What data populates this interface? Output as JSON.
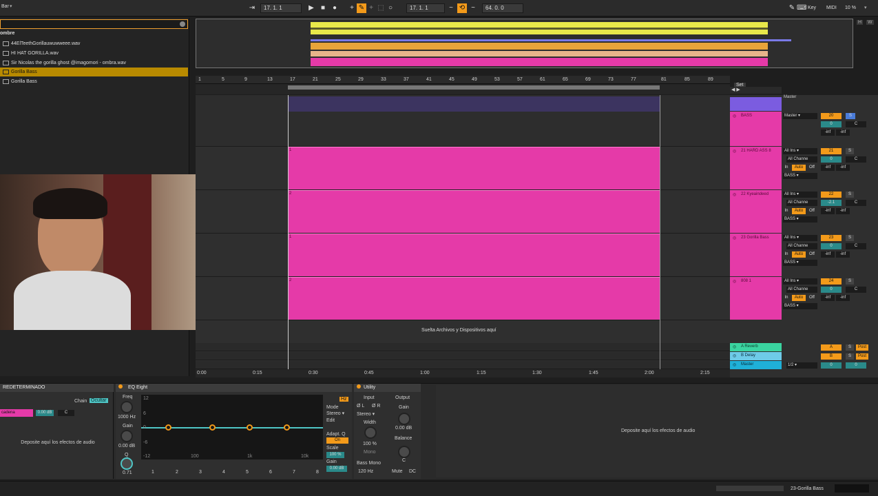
{
  "topbar": {
    "left_label": "Bar",
    "arr_pos": "17.  1.  1",
    "loop_pos": "17.  1.  1",
    "loop_len": "64.  0.  0",
    "key": "Key",
    "midi": "MIDI",
    "cpu": "10 %"
  },
  "browser": {
    "header": "ombre",
    "items": [
      {
        "label": "44ElTeethGorillauwuwweee.wav",
        "selected": false
      },
      {
        "label": "HI HAT GORILLA.wav",
        "selected": false
      },
      {
        "label": "Sir Nicolas the gorilla ghost @imagomori - ombra.wav",
        "selected": false
      },
      {
        "label": "Gorilla Bass",
        "selected": true
      },
      {
        "label": "Gorilla Bass",
        "selected": false
      }
    ]
  },
  "ruler": [
    "1",
    "5",
    "9",
    "13",
    "17",
    "21",
    "25",
    "29",
    "33",
    "37",
    "41",
    "45",
    "49",
    "53",
    "57",
    "61",
    "65",
    "69",
    "73",
    "77",
    "81",
    "85",
    "89"
  ],
  "set_label": "Set",
  "clip_numbers": [
    "1",
    "2",
    "1",
    "2",
    "1",
    "2",
    "1",
    "2",
    "1"
  ],
  "drop_text": "Suelta Archivos y Dispositivos aquí",
  "time_labels": [
    "0:00",
    "0:15",
    "0:30",
    "0:45",
    "1:00",
    "1:15",
    "1:30",
    "1:45",
    "2:00",
    "2:15"
  ],
  "mixer": {
    "top_label": "Master",
    "tracks": [
      {
        "name": "BASS",
        "in_label": "Master",
        "num": "20",
        "vol": "0",
        "pan": "C",
        "left_inf": "-inf",
        "right_inf": "-inf"
      },
      {
        "name": "21 HARD ASS 8",
        "in_label": "All Ins",
        "chan": "All Channe",
        "out": "BASS",
        "num": "21",
        "vol": "0",
        "pan": "C",
        "left_inf": "-inf",
        "right_inf": "-inf"
      },
      {
        "name": "22 Kyeaindeed",
        "in_label": "All Ins",
        "chan": "All Channe",
        "out": "BASS",
        "num": "22",
        "vol": "-2.1",
        "pan": "C",
        "left_inf": "-inf",
        "right_inf": "-inf"
      },
      {
        "name": "23 Gorilla Bass",
        "in_label": "All Ins",
        "chan": "All Channe",
        "out": "BASS",
        "num": "23",
        "vol": "0",
        "pan": "C",
        "left_inf": "-inf",
        "right_inf": "-inf"
      },
      {
        "name": "808 1",
        "in_label": "All Ins",
        "chan": "All Channe",
        "out": "BASS",
        "num": "24",
        "vol": "0",
        "pan": "C",
        "left_inf": "-inf",
        "right_inf": "-inf"
      }
    ],
    "monitor": {
      "in": "In",
      "auto": "Auto",
      "off": "Off"
    },
    "returns": [
      {
        "name": "A Reverb",
        "letter": "A",
        "post": "Post",
        "solo": "S"
      },
      {
        "name": "B Delay",
        "letter": "B",
        "post": "Post",
        "solo": "S"
      },
      {
        "name": "Master",
        "letter": "0",
        "cue": "1/2",
        "vol": "0"
      }
    ]
  },
  "devices": {
    "rack_title": "REDETERMINADO",
    "chain_label": "Chain",
    "chain_value": "Ocultar",
    "cadena": "cadena",
    "cadena_db": "0.00 dB",
    "cadena_c": "C",
    "drop_audio": "Deposite aquí los efectos de audio",
    "eq": {
      "title": "EQ Eight",
      "freq_label": "Freq",
      "freq_value": "1000 Hz",
      "gain_label": "Gain",
      "gain_value": "0.00 dB",
      "q_label": "Q",
      "q_value": "0.71",
      "db_ticks": [
        "12",
        "6",
        "0",
        "-6",
        "-12"
      ],
      "hz_ticks": [
        "100",
        "1k",
        "10k"
      ],
      "mode_label": "Mode",
      "mode_value": "Stereo",
      "edit_label": "Edit",
      "adapt_label": "Adapt. Q",
      "adapt_value": "On",
      "scale_label": "Scale",
      "scale_value": "100 %",
      "out_gain_label": "Gain",
      "out_gain_value": "0.00 dB",
      "bands": [
        "1",
        "2",
        "3",
        "4",
        "5",
        "6",
        "7",
        "8"
      ],
      "oversample": "Hz"
    },
    "utility": {
      "title": "Utility",
      "input_label": "Input",
      "output_label": "Output",
      "ph_l": "Ø L",
      "ph_r": "Ø R",
      "stereo": "Stereo",
      "width_label": "Width",
      "width_value": "100 %",
      "mono": "Mono",
      "bassmono_label": "Bass Mono",
      "bassmono_value": "120 Hz",
      "gain_label": "Gain",
      "gain_value": "0.00 dB",
      "balance_label": "Balance",
      "balance_value": "C",
      "mute": "Mute",
      "dc": "DC"
    },
    "drop_audio_right": "Deposite aquí los efectos de audio"
  },
  "status": {
    "track_name": "23-Gorilla Bass"
  },
  "colors": {
    "clip": "#e53aa8",
    "accent": "#f39a1a",
    "cyan": "#4fc6c6"
  }
}
